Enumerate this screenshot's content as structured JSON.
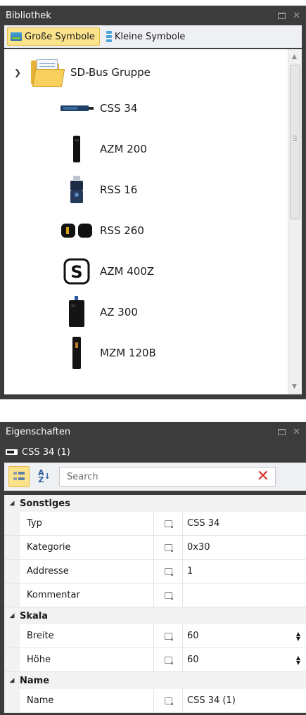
{
  "library": {
    "title": "Bibliothek",
    "view_large_label": "Große Symbole",
    "view_small_label": "Kleine Symbole",
    "group": {
      "label": "SD-Bus Gruppe",
      "icon": "folder-icon",
      "expanded": true
    },
    "devices": [
      {
        "label": "CSS 34",
        "icon": "css34-device-icon"
      },
      {
        "label": "AZM 200",
        "icon": "azm200-device-icon"
      },
      {
        "label": "RSS 16",
        "icon": "rss16-device-icon"
      },
      {
        "label": "RSS 260",
        "icon": "rss260-device-icon"
      },
      {
        "label": "AZM 400Z",
        "icon": "azm400z-device-icon"
      },
      {
        "label": "AZ 300",
        "icon": "az300-device-icon"
      },
      {
        "label": "MZM 120B",
        "icon": "mzm120b-device-icon"
      }
    ]
  },
  "properties": {
    "title": "Eigenschaften",
    "selected_object": "CSS 34 (1)",
    "search": {
      "placeholder": "Search",
      "value": ""
    },
    "categories": [
      {
        "name": "Sonstiges",
        "rows": [
          {
            "name": "Typ",
            "value": "CSS 34"
          },
          {
            "name": "Kategorie",
            "value": "0x30"
          },
          {
            "name": "Addresse",
            "value": "1"
          },
          {
            "name": "Kommentar",
            "value": ""
          }
        ]
      },
      {
        "name": "Skala",
        "rows": [
          {
            "name": "Breite",
            "value": "60",
            "spinner": true
          },
          {
            "name": "Höhe",
            "value": "60",
            "spinner": true
          }
        ]
      },
      {
        "name": "Name",
        "rows": [
          {
            "name": "Name",
            "value": "CSS 34 (1)"
          }
        ]
      }
    ]
  },
  "colors": {
    "panel_bg": "#3c3c3c",
    "active_btn": "#fbe38b",
    "clear_red": "#d9342b"
  }
}
